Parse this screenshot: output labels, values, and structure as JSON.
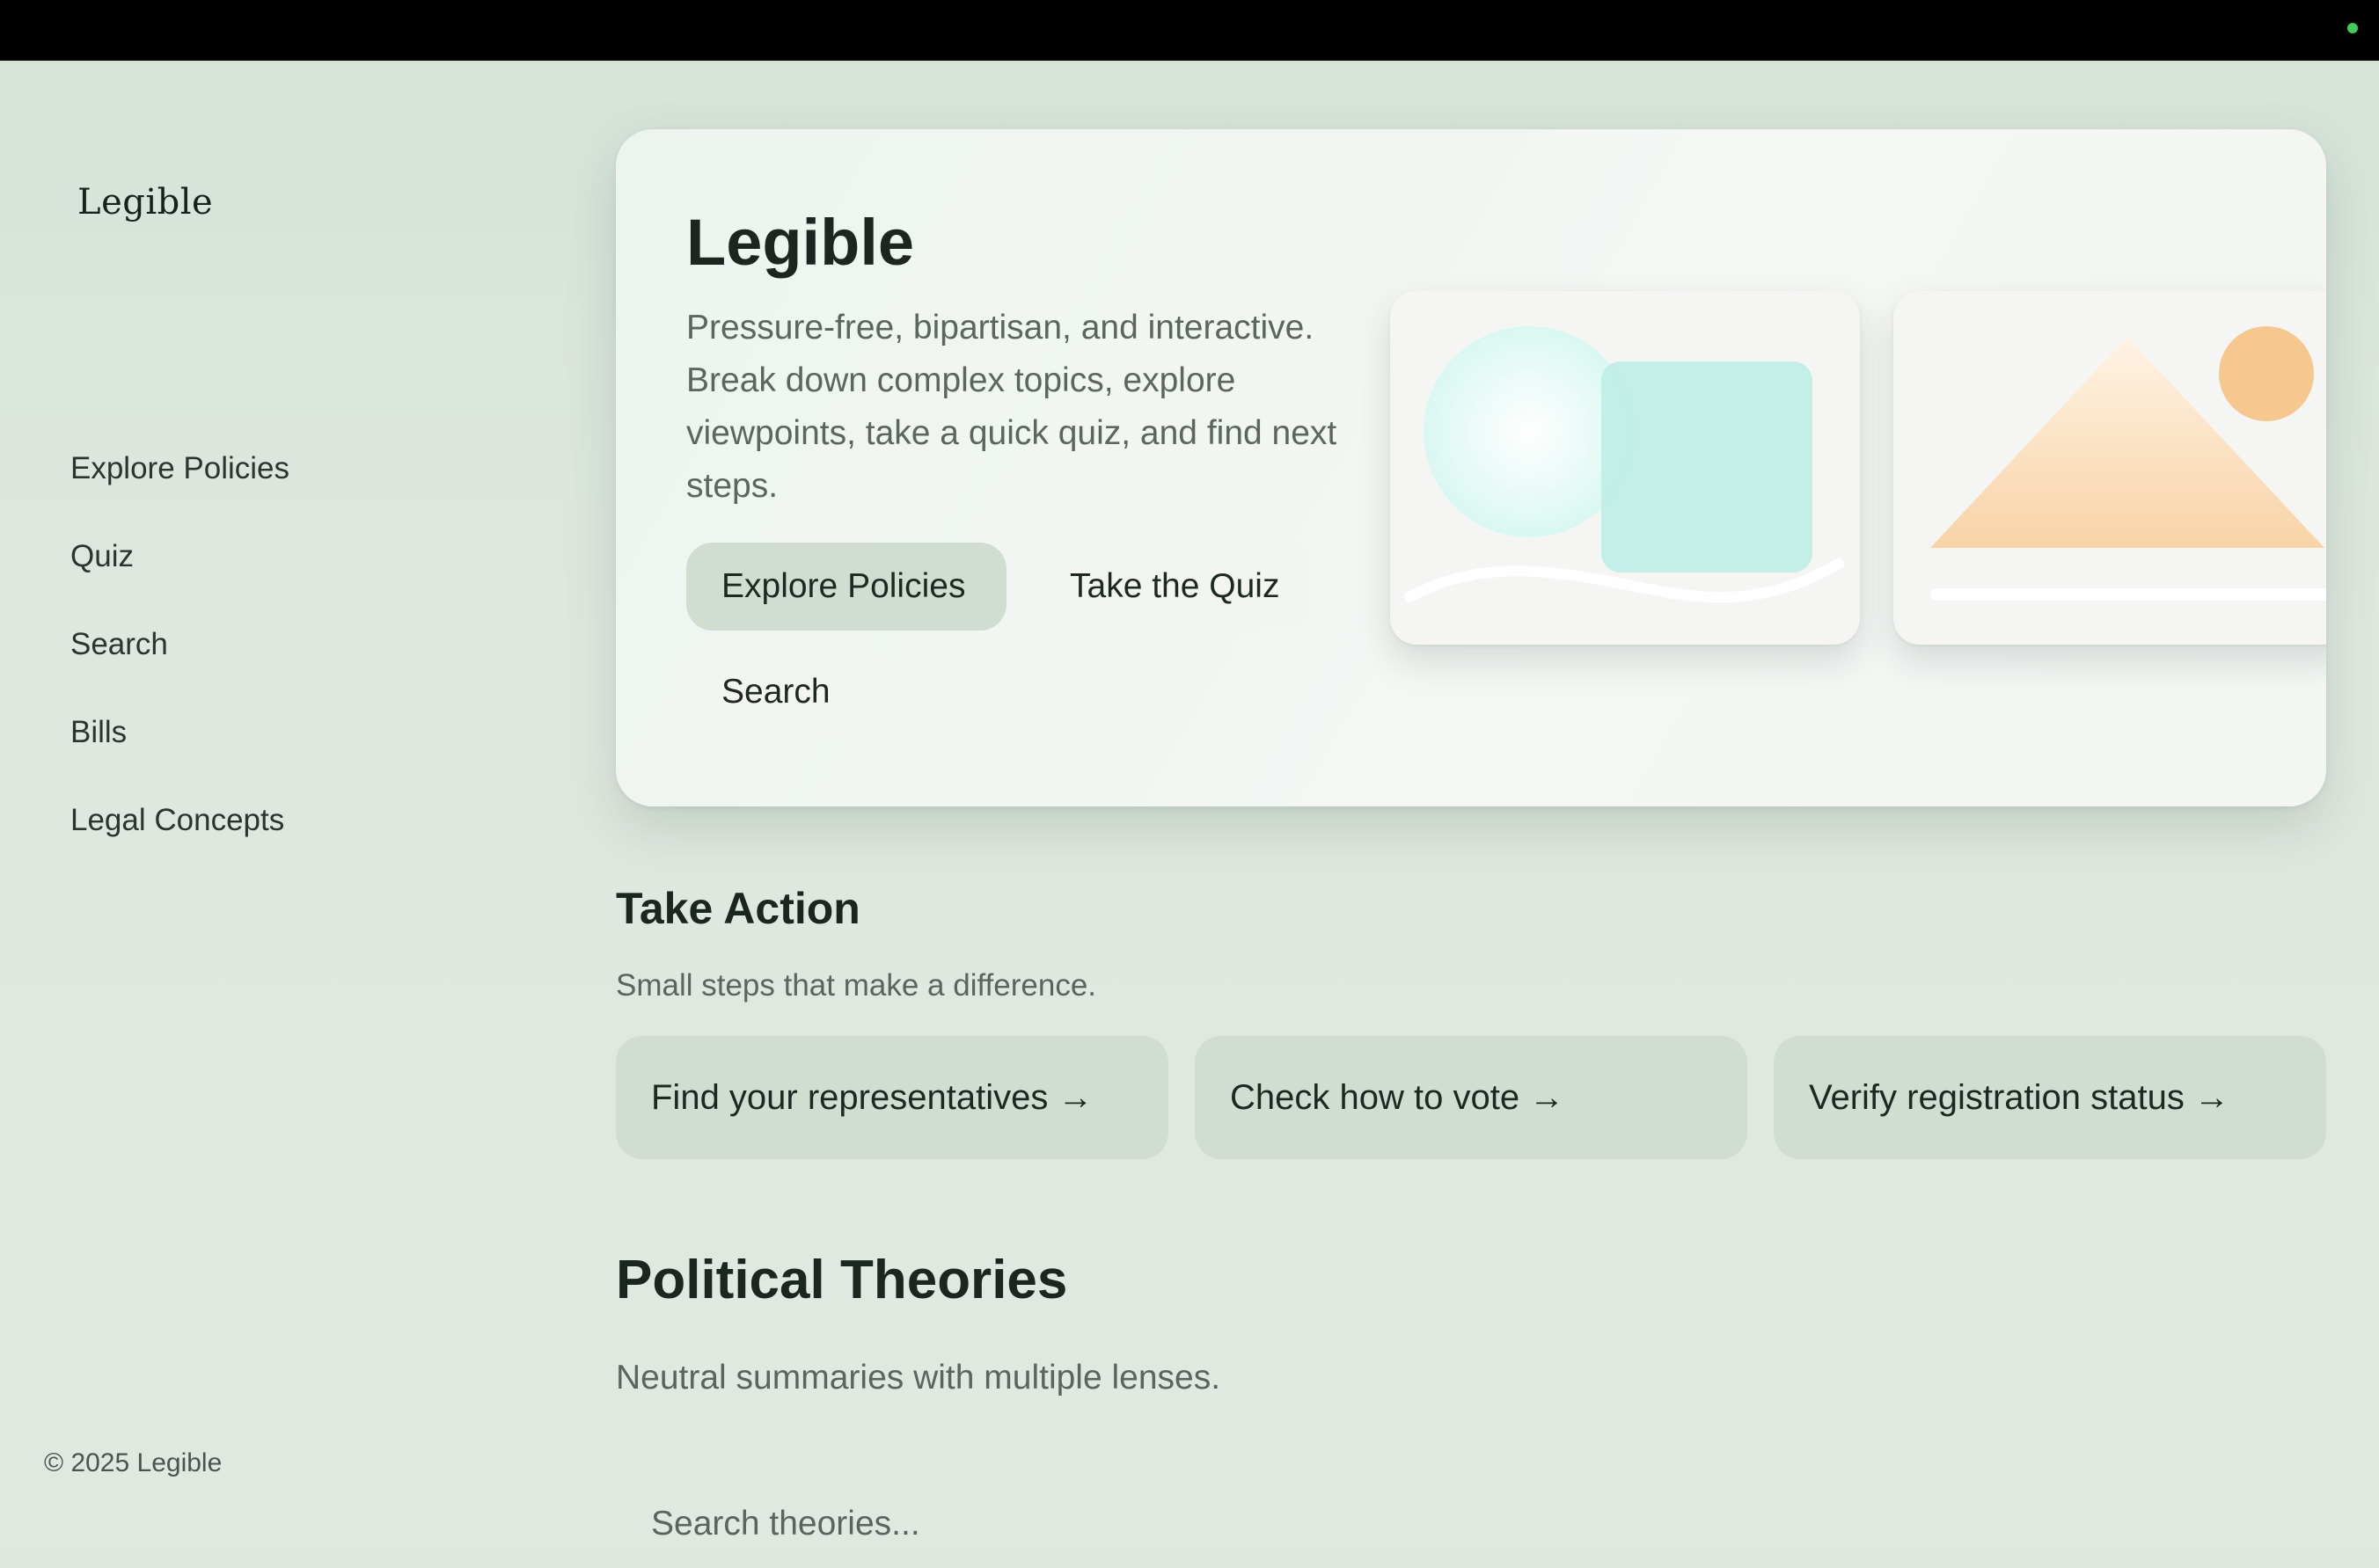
{
  "brand": "Legible",
  "nav": [
    {
      "label": "Explore Policies"
    },
    {
      "label": "Quiz"
    },
    {
      "label": "Search"
    },
    {
      "label": "Bills"
    },
    {
      "label": "Legal Concepts"
    }
  ],
  "footer": {
    "copyright": "© 2025 Legible"
  },
  "hero": {
    "title": "Legible",
    "description": "Pressure-free, bipartisan, and interactive. Break down complex topics, explore viewpoints, take a quick quiz, and find next steps.",
    "buttons": {
      "explore": "Explore Policies",
      "quiz": "Take the Quiz",
      "search": "Search"
    }
  },
  "take_action": {
    "title": "Take Action",
    "subtitle": "Small steps that make a difference.",
    "actions": [
      {
        "label": "Find your representatives →"
      },
      {
        "label": "Check how to vote →"
      },
      {
        "label": "Verify registration status →"
      }
    ]
  },
  "theories": {
    "title": "Political Theories",
    "subtitle": "Neutral summaries with multiple lenses.",
    "search_placeholder": "Search theories..."
  },
  "colors": {
    "background": "#dfe8df",
    "button": "#d2ddd2",
    "mint": "#bfeee6",
    "peach": "#f6c88f",
    "status_dot": "#3fce5a"
  }
}
